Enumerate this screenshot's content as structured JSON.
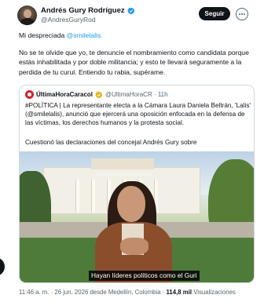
{
  "author": {
    "display_name": "Andrés Gury Rodríguez",
    "handle": "@AndresGuryRod",
    "follow_label": "Seguir"
  },
  "tweet": {
    "line1_prefix": "Mi despreciada ",
    "line1_mention": "@smilelalis",
    "paragraph2": "No se te olvide que yo, te denuncie el nombramiento como candidata porque estás inhabilitada y por doble militancia; y esto te llevará seguramente a la perdida de tu curul. Entiendo tu rabia, supérame."
  },
  "quote": {
    "name": "ÚltimaHoraCaracol",
    "handle_time": "@UltimaHoraCR · 11h",
    "text": "#POLÍTICA | La representante electa a la Cámara Laura Daniela Beltrán, 'Lalis' (@smilelalis), anunció que ejercerá una oposición enfocada en la defensa de las víctimas, los derechos humanos y la protesta social.",
    "text2": "Cuestionó las declaraciones del concejal Andrés Gury sobre",
    "video_caption": "Hayan líderes políticos como el Guri",
    "avatar_color": "#d4202a"
  },
  "footer": {
    "time_date": "11:46 a. m. · 26 jun. 2026 desde Medellín, Colombia · ",
    "views_count": "114,8 mil",
    "views_label": " Visualizaciones"
  },
  "colors": {
    "accent": "#1d9bf0",
    "text": "#0f1419",
    "muted": "#536471"
  }
}
